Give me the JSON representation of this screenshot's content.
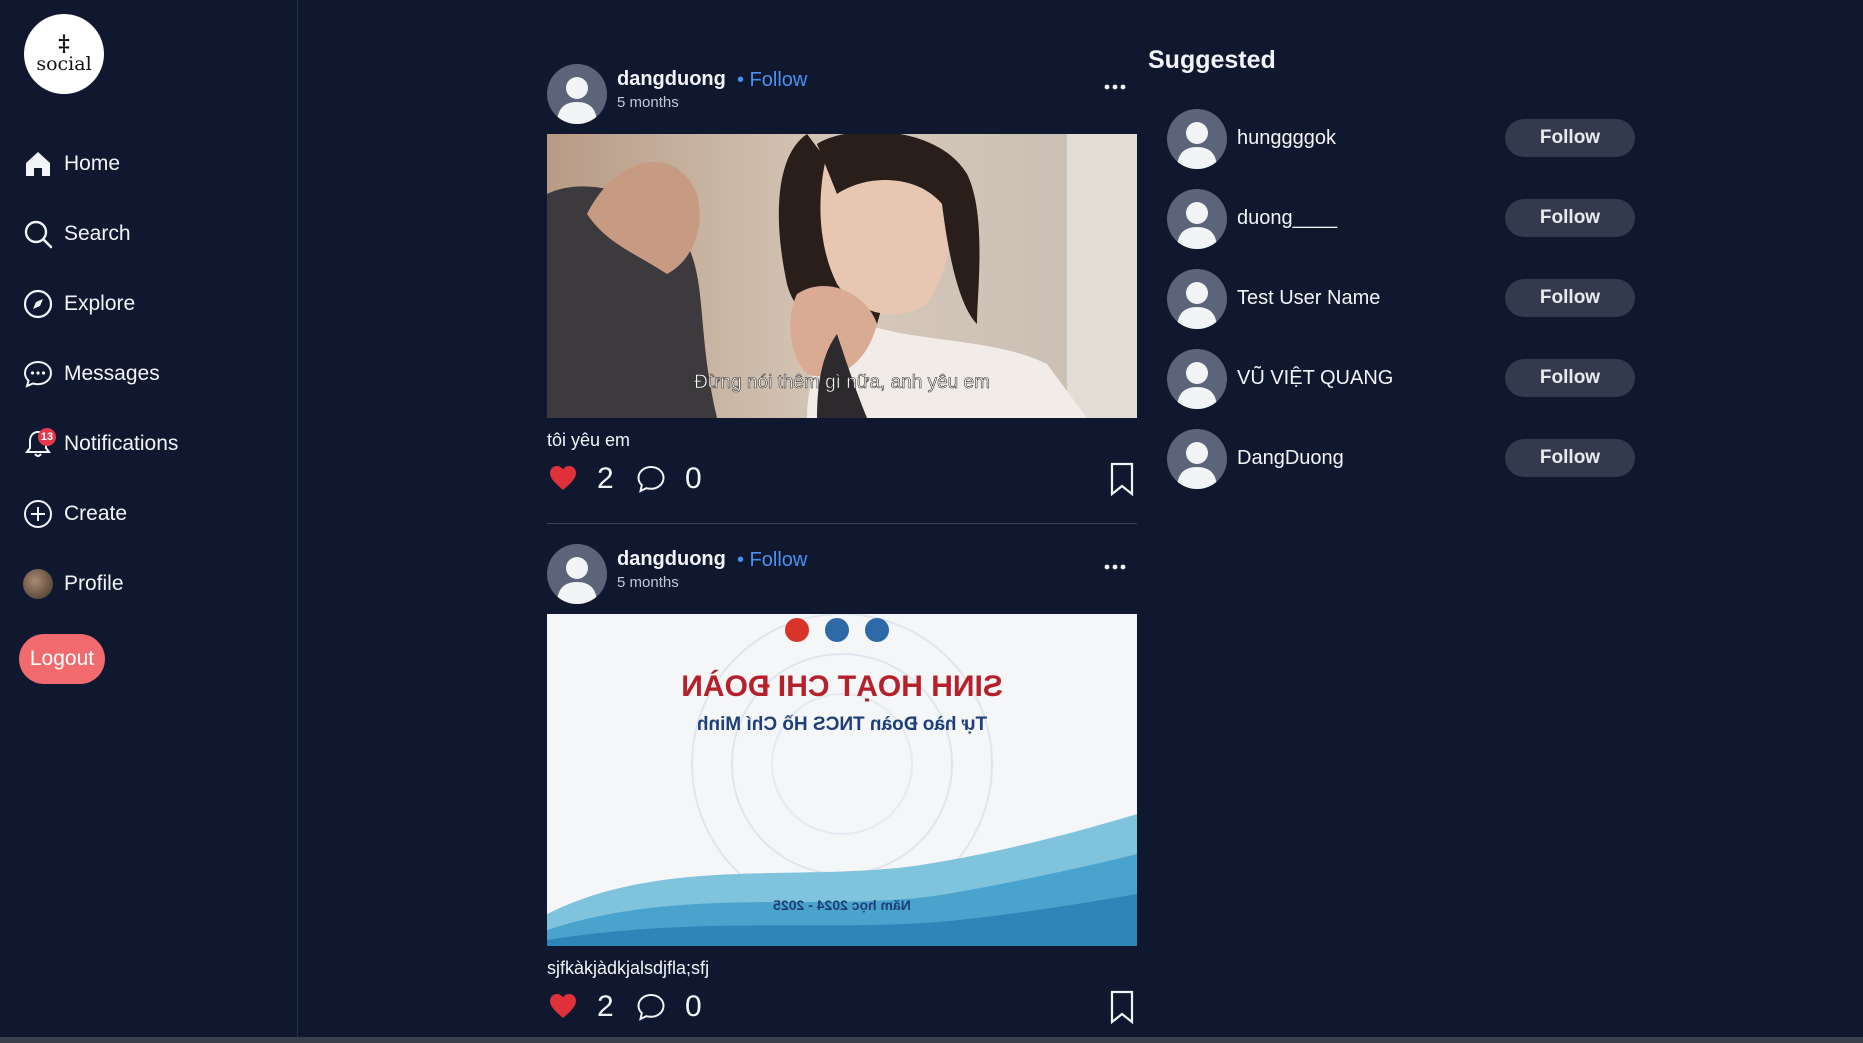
{
  "brand": {
    "logo_text": "social",
    "logo_mark": "‡"
  },
  "nav": {
    "items": [
      {
        "label": "Home",
        "icon": "home-icon"
      },
      {
        "label": "Search",
        "icon": "search-icon"
      },
      {
        "label": "Explore",
        "icon": "compass-icon"
      },
      {
        "label": "Messages",
        "icon": "chat-bubble-icon"
      },
      {
        "label": "Notifications",
        "icon": "bell-icon",
        "badge": "13"
      },
      {
        "label": "Create",
        "icon": "plus-circle-icon"
      },
      {
        "label": "Profile",
        "icon": "profile-avatar"
      }
    ],
    "logout_label": "Logout"
  },
  "posts": [
    {
      "username": "dangduong",
      "follow_label": "• Follow",
      "time": "5 months",
      "image_subtitle": "Đừng nói thêm gì nữa, anh yêu em",
      "caption": "tôi yêu em",
      "likes": "2",
      "comments": "0"
    },
    {
      "username": "dangduong",
      "follow_label": "• Follow",
      "time": "5 months",
      "image_title": "SINH HOẠT CHI ĐOÀN",
      "image_subtitle": "Tự hào Đoàn TNCS Hồ Chí Minh",
      "image_footer": "Năm học 2024 - 2025",
      "caption": "sjfkàkjàdkjalsdjfla;sfj",
      "likes": "2",
      "comments": "0"
    }
  ],
  "suggested": {
    "title": "Suggested",
    "users": [
      {
        "name": "hunggggok",
        "button": "Follow"
      },
      {
        "name": "duong____",
        "button": "Follow"
      },
      {
        "name": "Test User Name",
        "button": "Follow"
      },
      {
        "name": "VŨ VIỆT QUANG",
        "button": "Follow"
      },
      {
        "name": "DangDuong",
        "button": "Follow"
      }
    ]
  },
  "colors": {
    "background": "#101830",
    "follow_link": "#4a90f0",
    "like_heart": "#e0303c",
    "logout": "#f06a6e",
    "follow_button": "#333a4d"
  }
}
